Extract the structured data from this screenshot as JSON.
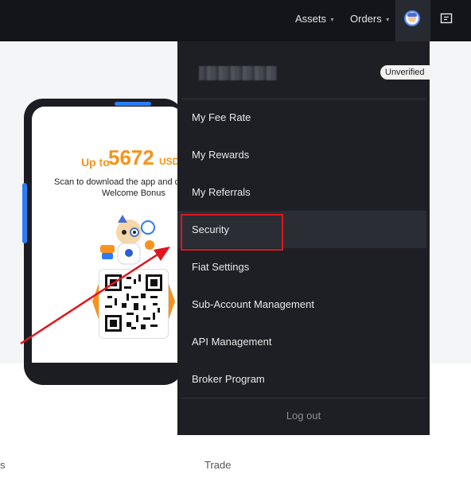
{
  "header": {
    "assets_label": "Assets",
    "orders_label": "Orders",
    "caret": "▼"
  },
  "promo": {
    "up_to": "Up to",
    "amount": "5672",
    "currency": "USD",
    "scan_text": "Scan to download the app and cl",
    "bonus_text": "Welcome Bonus"
  },
  "account_menu": {
    "status_badge": "Unverified",
    "items": [
      {
        "label": "My Fee Rate"
      },
      {
        "label": "My Rewards"
      },
      {
        "label": "My Referrals"
      },
      {
        "label": "Security"
      },
      {
        "label": "Fiat Settings"
      },
      {
        "label": "Sub-Account Management"
      },
      {
        "label": "API Management"
      },
      {
        "label": "Broker Program"
      }
    ],
    "logout_label": "Log out",
    "active_item": "Security"
  },
  "footer": {
    "left_label": "s",
    "trade_label": "Trade"
  },
  "colors": {
    "topbar": "#14151a",
    "menu_bg": "#1d1f24",
    "accent_orange": "#f7931a",
    "annotation_red": "#e2141c"
  },
  "icons": {
    "avatar": "user-avatar-icon",
    "notifications": "message-square-icon"
  }
}
